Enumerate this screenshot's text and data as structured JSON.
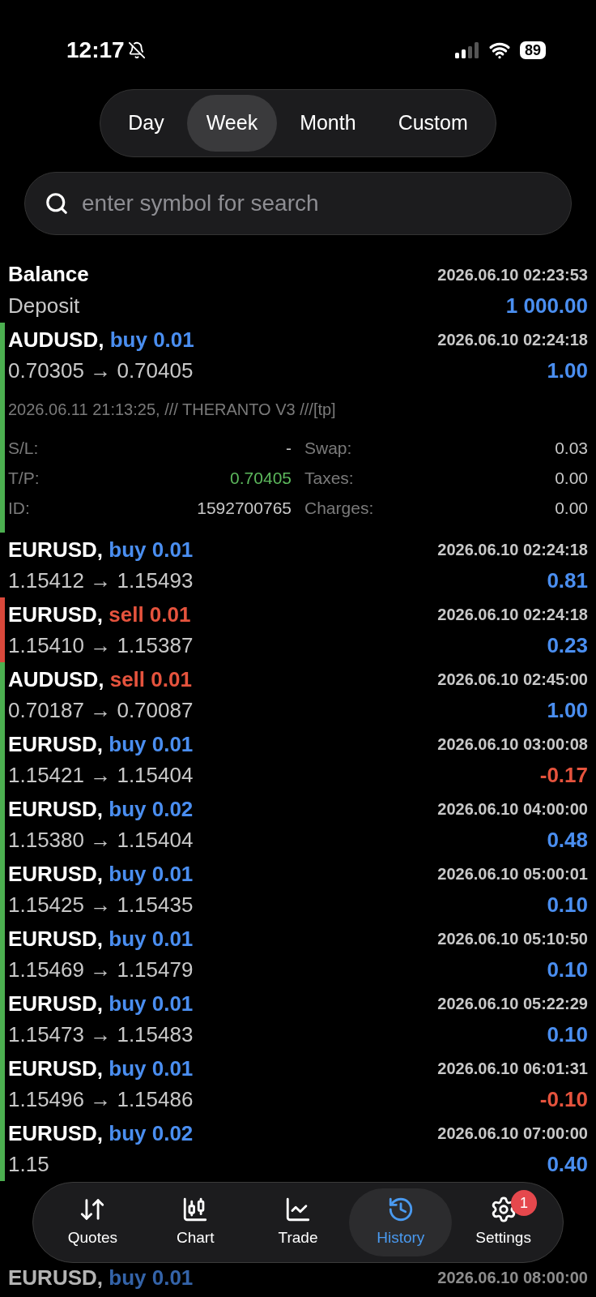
{
  "status_bar": {
    "time": "12:17",
    "battery": "89"
  },
  "period_tabs": [
    {
      "label": "Day",
      "selected": false
    },
    {
      "label": "Week",
      "selected": true
    },
    {
      "label": "Month",
      "selected": false
    },
    {
      "label": "Custom",
      "selected": false
    }
  ],
  "search": {
    "placeholder": "enter symbol for search"
  },
  "balance": {
    "title": "Balance",
    "time": "2026.06.10 02:23:53",
    "type": "Deposit",
    "amount": "1 000.00"
  },
  "deals": [
    {
      "symbol": "AUDUSD,",
      "sell": false,
      "order": "buy 0.01",
      "time": "2026.06.10 02:24:18",
      "prices": "0.70305 → 0.70405",
      "profit": "1.00",
      "loss": false,
      "color": "#4caf50",
      "expanded": true,
      "comment": "2026.06.11 21:13:25, /// THERANTO V3 ///[tp]",
      "detail_columns": [
        [
          {
            "label": "S/L:",
            "value": "-",
            "highlighted": false
          },
          {
            "label": "T/P:",
            "value": "0.70405",
            "highlighted": true
          },
          {
            "label": "ID:",
            "value": "1592700765",
            "highlighted": false
          }
        ],
        [
          {
            "label": "Swap:",
            "value": "0.03",
            "highlighted": false
          },
          {
            "label": "Taxes:",
            "value": "0.00",
            "highlighted": false
          },
          {
            "label": "Charges:",
            "value": "0.00",
            "highlighted": false
          }
        ]
      ]
    },
    {
      "symbol": "EURUSD,",
      "sell": false,
      "order": "buy 0.01",
      "time": "2026.06.10 02:24:18",
      "prices": "1.15412 → 1.15493",
      "profit": "0.81",
      "loss": false,
      "expanded": false
    },
    {
      "symbol": "EURUSD,",
      "sell": true,
      "order": "sell 0.01",
      "time": "2026.06.10 02:24:18",
      "prices": "1.15410 → 1.15387",
      "profit": "0.23",
      "loss": false,
      "color": "#d9483b",
      "expanded": false
    },
    {
      "symbol": "AUDUSD,",
      "sell": true,
      "order": "sell 0.01",
      "time": "2026.06.10 02:45:00",
      "prices": "0.70187 → 0.70087",
      "profit": "1.00",
      "loss": false,
      "color": "#4caf50",
      "expanded": false
    },
    {
      "symbol": "EURUSD,",
      "sell": false,
      "order": "buy 0.01",
      "time": "2026.06.10 03:00:08",
      "prices": "1.15421 → 1.15404",
      "profit": "-0.17",
      "loss": true,
      "color": "#4caf50",
      "expanded": false
    },
    {
      "symbol": "EURUSD,",
      "sell": false,
      "order": "buy 0.02",
      "time": "2026.06.10 04:00:00",
      "prices": "1.15380 → 1.15404",
      "profit": "0.48",
      "loss": false,
      "color": "#4caf50",
      "expanded": false
    },
    {
      "symbol": "EURUSD,",
      "sell": false,
      "order": "buy 0.01",
      "time": "2026.06.10 05:00:01",
      "prices": "1.15425 → 1.15435",
      "profit": "0.10",
      "loss": false,
      "color": "#4caf50",
      "expanded": false
    },
    {
      "symbol": "EURUSD,",
      "sell": false,
      "order": "buy 0.01",
      "time": "2026.06.10 05:10:50",
      "prices": "1.15469 → 1.15479",
      "profit": "0.10",
      "loss": false,
      "color": "#4caf50",
      "expanded": false
    },
    {
      "symbol": "EURUSD,",
      "sell": false,
      "order": "buy 0.01",
      "time": "2026.06.10 05:22:29",
      "prices": "1.15473 → 1.15483",
      "profit": "0.10",
      "loss": false,
      "color": "#4caf50",
      "expanded": false
    },
    {
      "symbol": "EURUSD,",
      "sell": false,
      "order": "buy 0.01",
      "time": "2026.06.10 06:01:31",
      "prices": "1.15496 → 1.15486",
      "profit": "-0.10",
      "loss": true,
      "color": "#4caf50",
      "expanded": false
    },
    {
      "symbol": "EURUSD,",
      "sell": false,
      "order": "buy 0.02",
      "time": "2026.06.10 07:00:00",
      "prices": "1.15",
      "profit": "0.40",
      "loss": false,
      "color": "#4caf50",
      "expanded": false
    }
  ],
  "last_deal": {
    "symbol": "EURUSD,",
    "sell": false,
    "order": "buy 0.01",
    "time": "2026.06.10 08:00:00"
  },
  "bottom_nav": [
    {
      "kind": "quotes",
      "label": "Quotes",
      "selected": false
    },
    {
      "kind": "chart",
      "label": "Chart",
      "selected": false
    },
    {
      "kind": "trade",
      "label": "Trade",
      "selected": false
    },
    {
      "kind": "history",
      "label": "History",
      "selected": true
    },
    {
      "kind": "settings",
      "label": "Settings",
      "selected": false,
      "badge": "1"
    }
  ]
}
